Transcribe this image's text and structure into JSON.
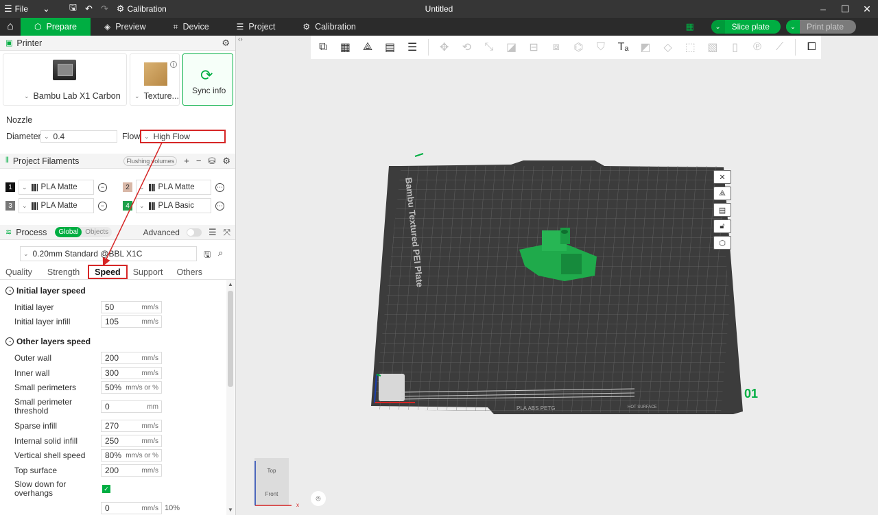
{
  "titlebar": {
    "file_menu": "File",
    "calibration": "Calibration",
    "window_title": "Untitled"
  },
  "nav": {
    "tabs": [
      {
        "label": "Prepare"
      },
      {
        "label": "Preview"
      },
      {
        "label": "Device"
      },
      {
        "label": "Project"
      },
      {
        "label": "Calibration"
      }
    ],
    "slice_plate": "Slice plate",
    "print_plate": "Print plate"
  },
  "printer": {
    "header": "Printer",
    "printer_name": "Bambu Lab X1 Carbon",
    "plate_name": "Texture...",
    "sync_info": "Sync info",
    "nozzle_label": "Nozzle",
    "diameter_label": "Diameter",
    "diameter_value": "0.4",
    "flow_label": "Flow",
    "flow_value": "High Flow"
  },
  "filaments": {
    "header": "Project Filaments",
    "flushing": "Flushing volumes",
    "items": [
      {
        "num": "1",
        "name": "PLA Matte",
        "color": "#111111"
      },
      {
        "num": "2",
        "name": "PLA Matte",
        "color": "#d9b8a8"
      },
      {
        "num": "3",
        "name": "PLA Matte",
        "color": "#777777"
      },
      {
        "num": "4",
        "name": "PLA Basic",
        "color": "#1ea04a"
      }
    ]
  },
  "process": {
    "header": "Process",
    "global": "Global",
    "objects": "Objects",
    "advanced": "Advanced",
    "profile": "0.20mm Standard @BBL X1C",
    "subtabs": [
      "Quality",
      "Strength",
      "Speed",
      "Support",
      "Others"
    ],
    "group1": "Initial layer speed",
    "group2": "Other layers speed",
    "params1": [
      {
        "label": "Initial layer",
        "value": "50",
        "unit": "mm/s"
      },
      {
        "label": "Initial layer infill",
        "value": "105",
        "unit": "mm/s"
      }
    ],
    "params2": [
      {
        "label": "Outer wall",
        "value": "200",
        "unit": "mm/s"
      },
      {
        "label": "Inner wall",
        "value": "300",
        "unit": "mm/s"
      },
      {
        "label": "Small perimeters",
        "value": "50%",
        "unit": "mm/s or %"
      },
      {
        "label": "Small perimeter threshold",
        "value": "0",
        "unit": "mm"
      },
      {
        "label": "Sparse infill",
        "value": "270",
        "unit": "mm/s"
      },
      {
        "label": "Internal solid infill",
        "value": "250",
        "unit": "mm/s"
      },
      {
        "label": "Vertical shell speed",
        "value": "80%",
        "unit": "mm/s or %"
      },
      {
        "label": "Top surface",
        "value": "200",
        "unit": "mm/s"
      },
      {
        "label": "Slow down for overhangs",
        "checked": true
      },
      {
        "label": "",
        "value": "0",
        "unit": "mm/s",
        "extra": "10%"
      }
    ]
  },
  "viewport": {
    "plate_label": "Bambu Textured PEI Plate",
    "plate_number": "01",
    "plate_footer": "PLA ABS PETG",
    "plate_footer_small": "HOT SURFACE",
    "viewcube_top": "Top",
    "viewcube_front": "Front",
    "axis_x": "x"
  },
  "colors": {
    "accent": "#00ae42",
    "plate": "#3c3c3c",
    "annotation": "#d62626"
  }
}
